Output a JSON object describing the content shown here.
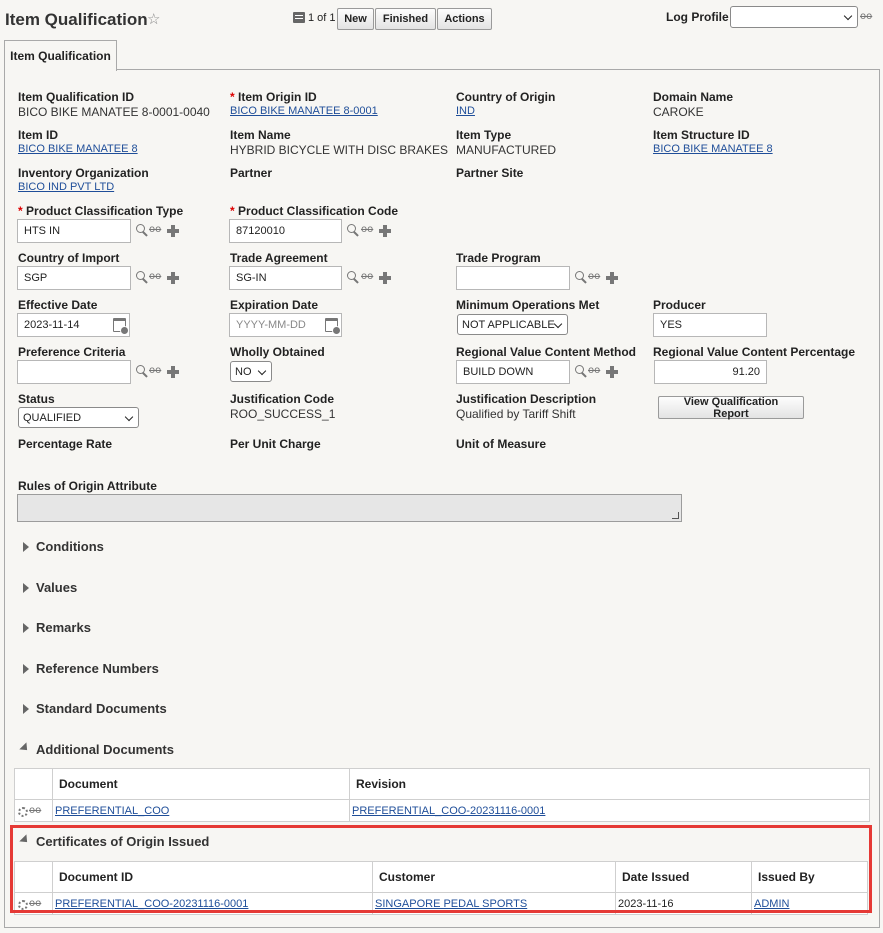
{
  "header": {
    "title": "Item Qualification",
    "record_count": "1 of 1",
    "buttons": {
      "new": "New",
      "finished": "Finished",
      "actions": "Actions"
    },
    "log_profile_label": "Log Profile",
    "log_profile_value": ""
  },
  "tab": {
    "label": "Item Qualification"
  },
  "fields": {
    "item_qualification_id": {
      "label": "Item Qualification ID",
      "value": "BICO BIKE MANATEE 8-0001-0040"
    },
    "item_origin_id": {
      "label": "Item Origin ID",
      "value": "BICO BIKE MANATEE 8-0001"
    },
    "country_of_origin": {
      "label": "Country of Origin",
      "value": "IND"
    },
    "domain_name": {
      "label": "Domain Name",
      "value": "CAROKE"
    },
    "item_id": {
      "label": "Item ID",
      "value": "BICO BIKE MANATEE 8"
    },
    "item_name": {
      "label": "Item Name",
      "value": "HYBRID BICYCLE WITH DISC BRAKES"
    },
    "item_type": {
      "label": "Item Type",
      "value": "MANUFACTURED"
    },
    "item_structure_id": {
      "label": "Item Structure ID",
      "value": "BICO BIKE MANATEE 8"
    },
    "inventory_organization": {
      "label": "Inventory Organization",
      "value": "BICO IND PVT LTD"
    },
    "partner": {
      "label": "Partner"
    },
    "partner_site": {
      "label": "Partner Site"
    },
    "product_classification_type": {
      "label": "Product Classification Type",
      "value": "HTS IN"
    },
    "product_classification_code": {
      "label": "Product Classification Code",
      "value": "87120010"
    },
    "country_of_import": {
      "label": "Country of Import",
      "value": "SGP"
    },
    "trade_agreement": {
      "label": "Trade Agreement",
      "value": "SG-IN"
    },
    "trade_program": {
      "label": "Trade Program",
      "value": ""
    },
    "effective_date": {
      "label": "Effective Date",
      "value": "2023-11-14"
    },
    "expiration_date": {
      "label": "Expiration Date",
      "placeholder": "YYYY-MM-DD"
    },
    "minimum_operations_met": {
      "label": "Minimum Operations Met",
      "value": "NOT APPLICABLE"
    },
    "producer": {
      "label": "Producer",
      "value": "YES"
    },
    "preference_criteria": {
      "label": "Preference Criteria",
      "value": ""
    },
    "wholly_obtained": {
      "label": "Wholly Obtained",
      "value": "NO"
    },
    "rvc_method": {
      "label": "Regional Value Content Method",
      "value": "BUILD DOWN"
    },
    "rvc_percentage": {
      "label": "Regional Value Content Percentage",
      "value": "91.20"
    },
    "status": {
      "label": "Status",
      "value": "QUALIFIED"
    },
    "justification_code": {
      "label": "Justification Code",
      "value": "ROO_SUCCESS_1"
    },
    "justification_description": {
      "label": "Justification Description",
      "value": "Qualified by Tariff Shift"
    },
    "view_report_button": "View Qualification Report",
    "percentage_rate": {
      "label": "Percentage Rate"
    },
    "per_unit_charge": {
      "label": "Per Unit Charge"
    },
    "unit_of_measure": {
      "label": "Unit of Measure"
    },
    "rules_of_origin_attribute": {
      "label": "Rules of Origin Attribute"
    }
  },
  "sections": {
    "conditions": "Conditions",
    "values": "Values",
    "remarks": "Remarks",
    "reference_numbers": "Reference Numbers",
    "standard_documents": "Standard Documents",
    "additional_documents": "Additional Documents",
    "certificates": "Certificates of Origin Issued"
  },
  "additional_documents_table": {
    "headers": [
      "Document",
      "Revision"
    ],
    "rows": [
      {
        "document": "PREFERENTIAL_COO",
        "revision": "PREFERENTIAL_COO-20231116-0001"
      }
    ]
  },
  "certificates_table": {
    "headers": [
      "Document ID",
      "Customer",
      "Date Issued",
      "Issued By"
    ],
    "rows": [
      {
        "document_id": "PREFERENTIAL_COO-20231116-0001",
        "customer": "SINGAPORE PEDAL SPORTS",
        "date_issued": "2023-11-16",
        "issued_by": "ADMIN"
      }
    ]
  },
  "icons": [
    "star-icon",
    "record-list-icon",
    "search-icon",
    "glasses-icon",
    "plus-icon",
    "calendar-icon",
    "gear-icon",
    "expand-triangle-icon",
    "collapse-triangle-icon"
  ],
  "colors": {
    "link": "#1f4e99",
    "required": "#dd0000",
    "highlight": "#e53935",
    "background": "#f7f6f3"
  }
}
